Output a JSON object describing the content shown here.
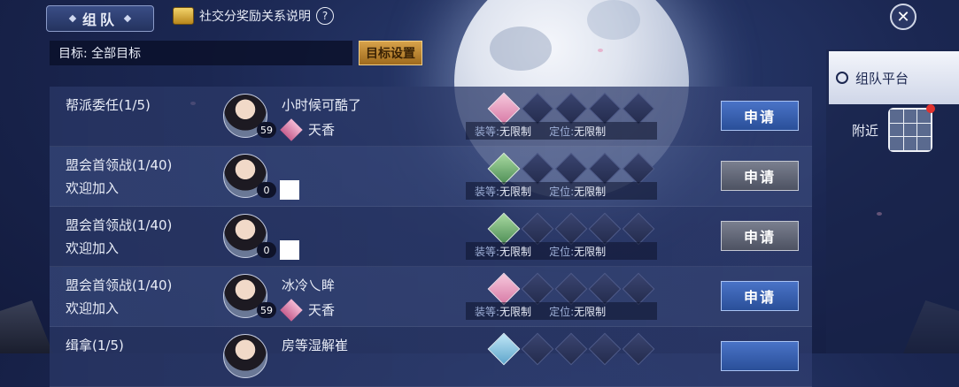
{
  "header": {
    "title": "组队",
    "info_link": "社交分奖励关系说明",
    "help_glyph": "?",
    "close_glyph": "✕"
  },
  "target": {
    "label": "目标: 全部目标",
    "button": "目标设置"
  },
  "sidebar": {
    "tabs": [
      {
        "label": "组队平台",
        "active": true
      },
      {
        "label": "附近"
      }
    ]
  },
  "rows": [
    {
      "task": "帮派委任(1/5)",
      "desc": "",
      "level": "59",
      "leader": "小时候可酷了",
      "sect": "天香",
      "slot_color": "pink",
      "req_level_label": "装等:",
      "req_level": "无限制",
      "req_role_label": "定位:",
      "req_role": "无限制",
      "apply": "申请",
      "apply_style": "blue"
    },
    {
      "task": "盟会首领战(1/40)",
      "desc": "欢迎加入",
      "level": "0",
      "leader": "",
      "sect": "",
      "slot_color": "green",
      "req_level_label": "装等:",
      "req_level": "无限制",
      "req_role_label": "定位:",
      "req_role": "无限制",
      "apply": "申请",
      "apply_style": "gray"
    },
    {
      "task": "盟会首领战(1/40)",
      "desc": "欢迎加入",
      "level": "0",
      "leader": "",
      "sect": "",
      "slot_color": "green",
      "req_level_label": "装等:",
      "req_level": "无限制",
      "req_role_label": "定位:",
      "req_role": "无限制",
      "apply": "申请",
      "apply_style": "gray"
    },
    {
      "task": "盟会首领战(1/40)",
      "desc": "欢迎加入",
      "level": "59",
      "leader": "冰冷乀眸",
      "sect": "天香",
      "slot_color": "pink",
      "req_level_label": "装等:",
      "req_level": "无限制",
      "req_role_label": "定位:",
      "req_role": "无限制",
      "apply": "申请",
      "apply_style": "blue"
    },
    {
      "task": "缉拿(1/5)",
      "desc": "",
      "level": "",
      "leader": "房等湿解崔",
      "sect": "",
      "slot_color": "blue",
      "req_level_label": "",
      "req_level": "",
      "req_role_label": "",
      "req_role": "",
      "apply": "",
      "apply_style": "blue"
    }
  ]
}
